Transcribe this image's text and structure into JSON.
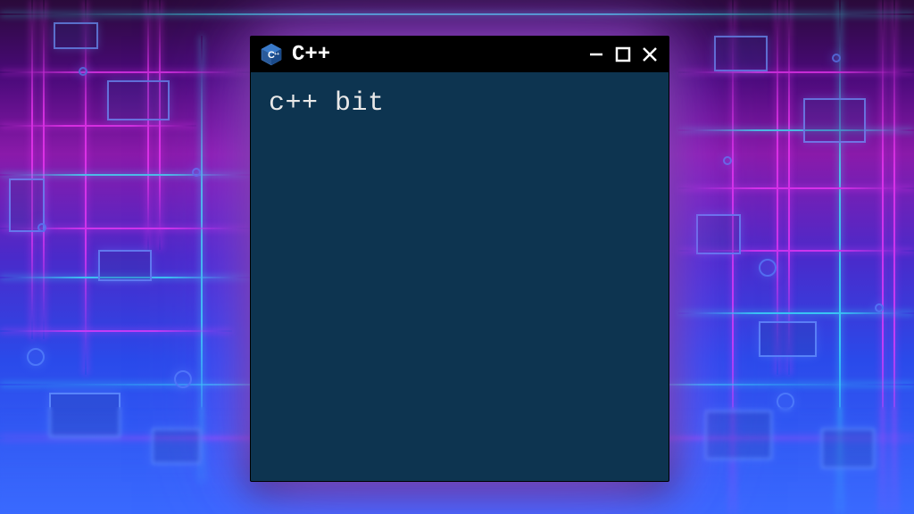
{
  "window": {
    "title": "C++",
    "icon_name": "cpp-logo-icon",
    "controls": {
      "minimize": "minimize",
      "maximize": "maximize",
      "close": "close"
    }
  },
  "content": {
    "text": "c++ bit"
  },
  "colors": {
    "window_bg": "#0d3450",
    "titlebar_bg": "#000000",
    "text": "#e8e8e8",
    "glow": "#c864ff"
  }
}
